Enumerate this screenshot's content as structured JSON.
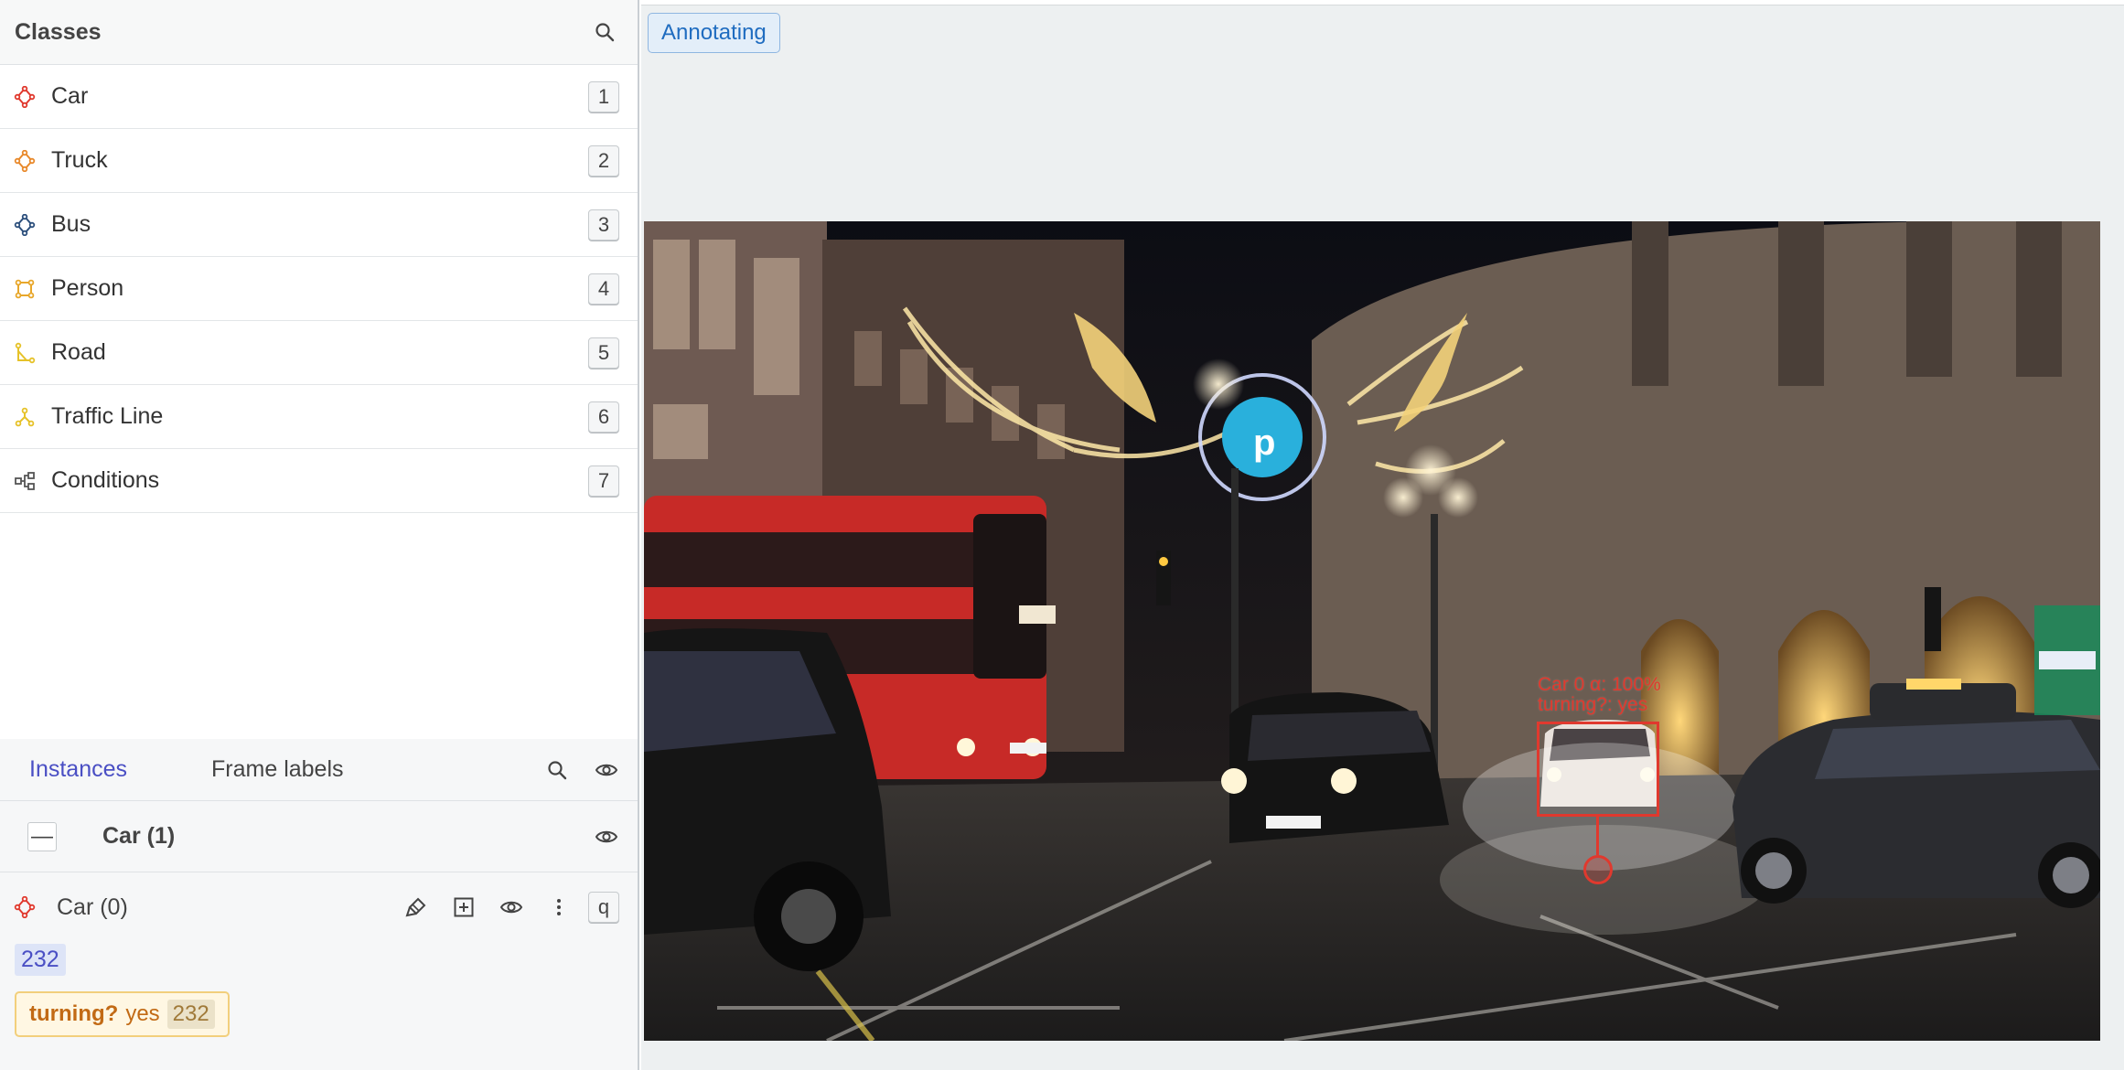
{
  "classes_panel": {
    "title": "Classes",
    "items": [
      {
        "label": "Car",
        "hotkey": "1",
        "color": "#e0392e",
        "icon": "polygon-icon"
      },
      {
        "label": "Truck",
        "hotkey": "2",
        "color": "#e8892b",
        "icon": "polygon-icon"
      },
      {
        "label": "Bus",
        "hotkey": "3",
        "color": "#2c4f7c",
        "icon": "polygon-icon"
      },
      {
        "label": "Person",
        "hotkey": "4",
        "color": "#e8a72b",
        "icon": "bounding-box-icon"
      },
      {
        "label": "Road",
        "hotkey": "5",
        "color": "#e6c229",
        "icon": "polyline-icon"
      },
      {
        "label": "Traffic Line",
        "hotkey": "6",
        "color": "#e6c229",
        "icon": "skeleton-icon"
      },
      {
        "label": "Conditions",
        "hotkey": "7",
        "color": "#555555",
        "icon": "hierarchy-icon"
      }
    ]
  },
  "instances_panel": {
    "tabs": [
      "Instances",
      "Frame labels"
    ],
    "active_tab": "Instances",
    "group": {
      "label": "Car (1)",
      "collapse_symbol": "—"
    },
    "instance": {
      "label": "Car (0)",
      "hotkey": "q",
      "id": "232",
      "attribute": {
        "name": "turning?",
        "value": "yes",
        "id": "232"
      }
    }
  },
  "canvas": {
    "status": "Annotating",
    "bbox_label_line1": "Car 0 α: 100%",
    "bbox_label_line2": "turning?: yes",
    "accent_color": "#e0392e"
  }
}
